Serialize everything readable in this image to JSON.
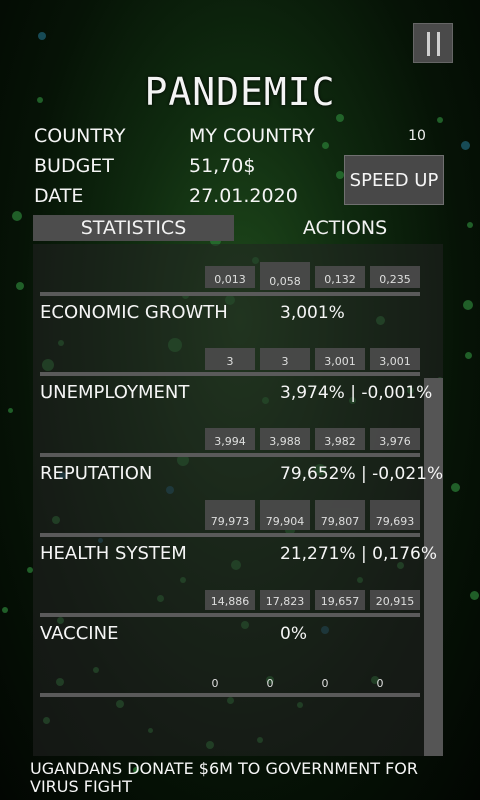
{
  "header": {
    "title": "PANDEMIC",
    "count": "10",
    "speed_button": "SPEED UP"
  },
  "info": {
    "country_label": "COUNTRY",
    "country_value": "MY COUNTRY",
    "budget_label": "BUDGET",
    "budget_value": "51,70$",
    "date_label": "DATE",
    "date_value": "27.01.2020"
  },
  "tabs": {
    "statistics": "STATISTICS",
    "actions": "ACTIONS"
  },
  "stats": [
    {
      "label": "ECONOMIC GROWTH",
      "value": "3,001%",
      "history": [
        "0,013",
        "0,058",
        "0,132",
        "0,235"
      ]
    },
    {
      "label": "UNEMPLOYMENT",
      "value": "3,974% | -0,001%",
      "history": [
        "3",
        "3",
        "3,001",
        "3,001"
      ]
    },
    {
      "label": "REPUTATION",
      "value": "79,652% | -0,021%",
      "history": [
        "3,994",
        "3,988",
        "3,982",
        "3,976"
      ]
    },
    {
      "label": "HEALTH SYSTEM",
      "value": "21,271% | 0,176%",
      "history": [
        "79,973",
        "79,904",
        "79,807",
        "79,693"
      ]
    },
    {
      "label": "VACCINE",
      "value": "0%",
      "history": [
        "14,886",
        "17,823",
        "19,657",
        "20,915"
      ]
    },
    {
      "label": "",
      "value": "",
      "history": [
        "0",
        "0",
        "0",
        "0"
      ]
    }
  ],
  "news": "UGANDANS DONATE $6M TO GOVERNMENT FOR VIRUS FIGHT",
  "colors": {
    "panel": "#3a3a3a",
    "button": "#484848",
    "virus_green": "#2a7a34",
    "virus_blue": "#1e5f72"
  }
}
